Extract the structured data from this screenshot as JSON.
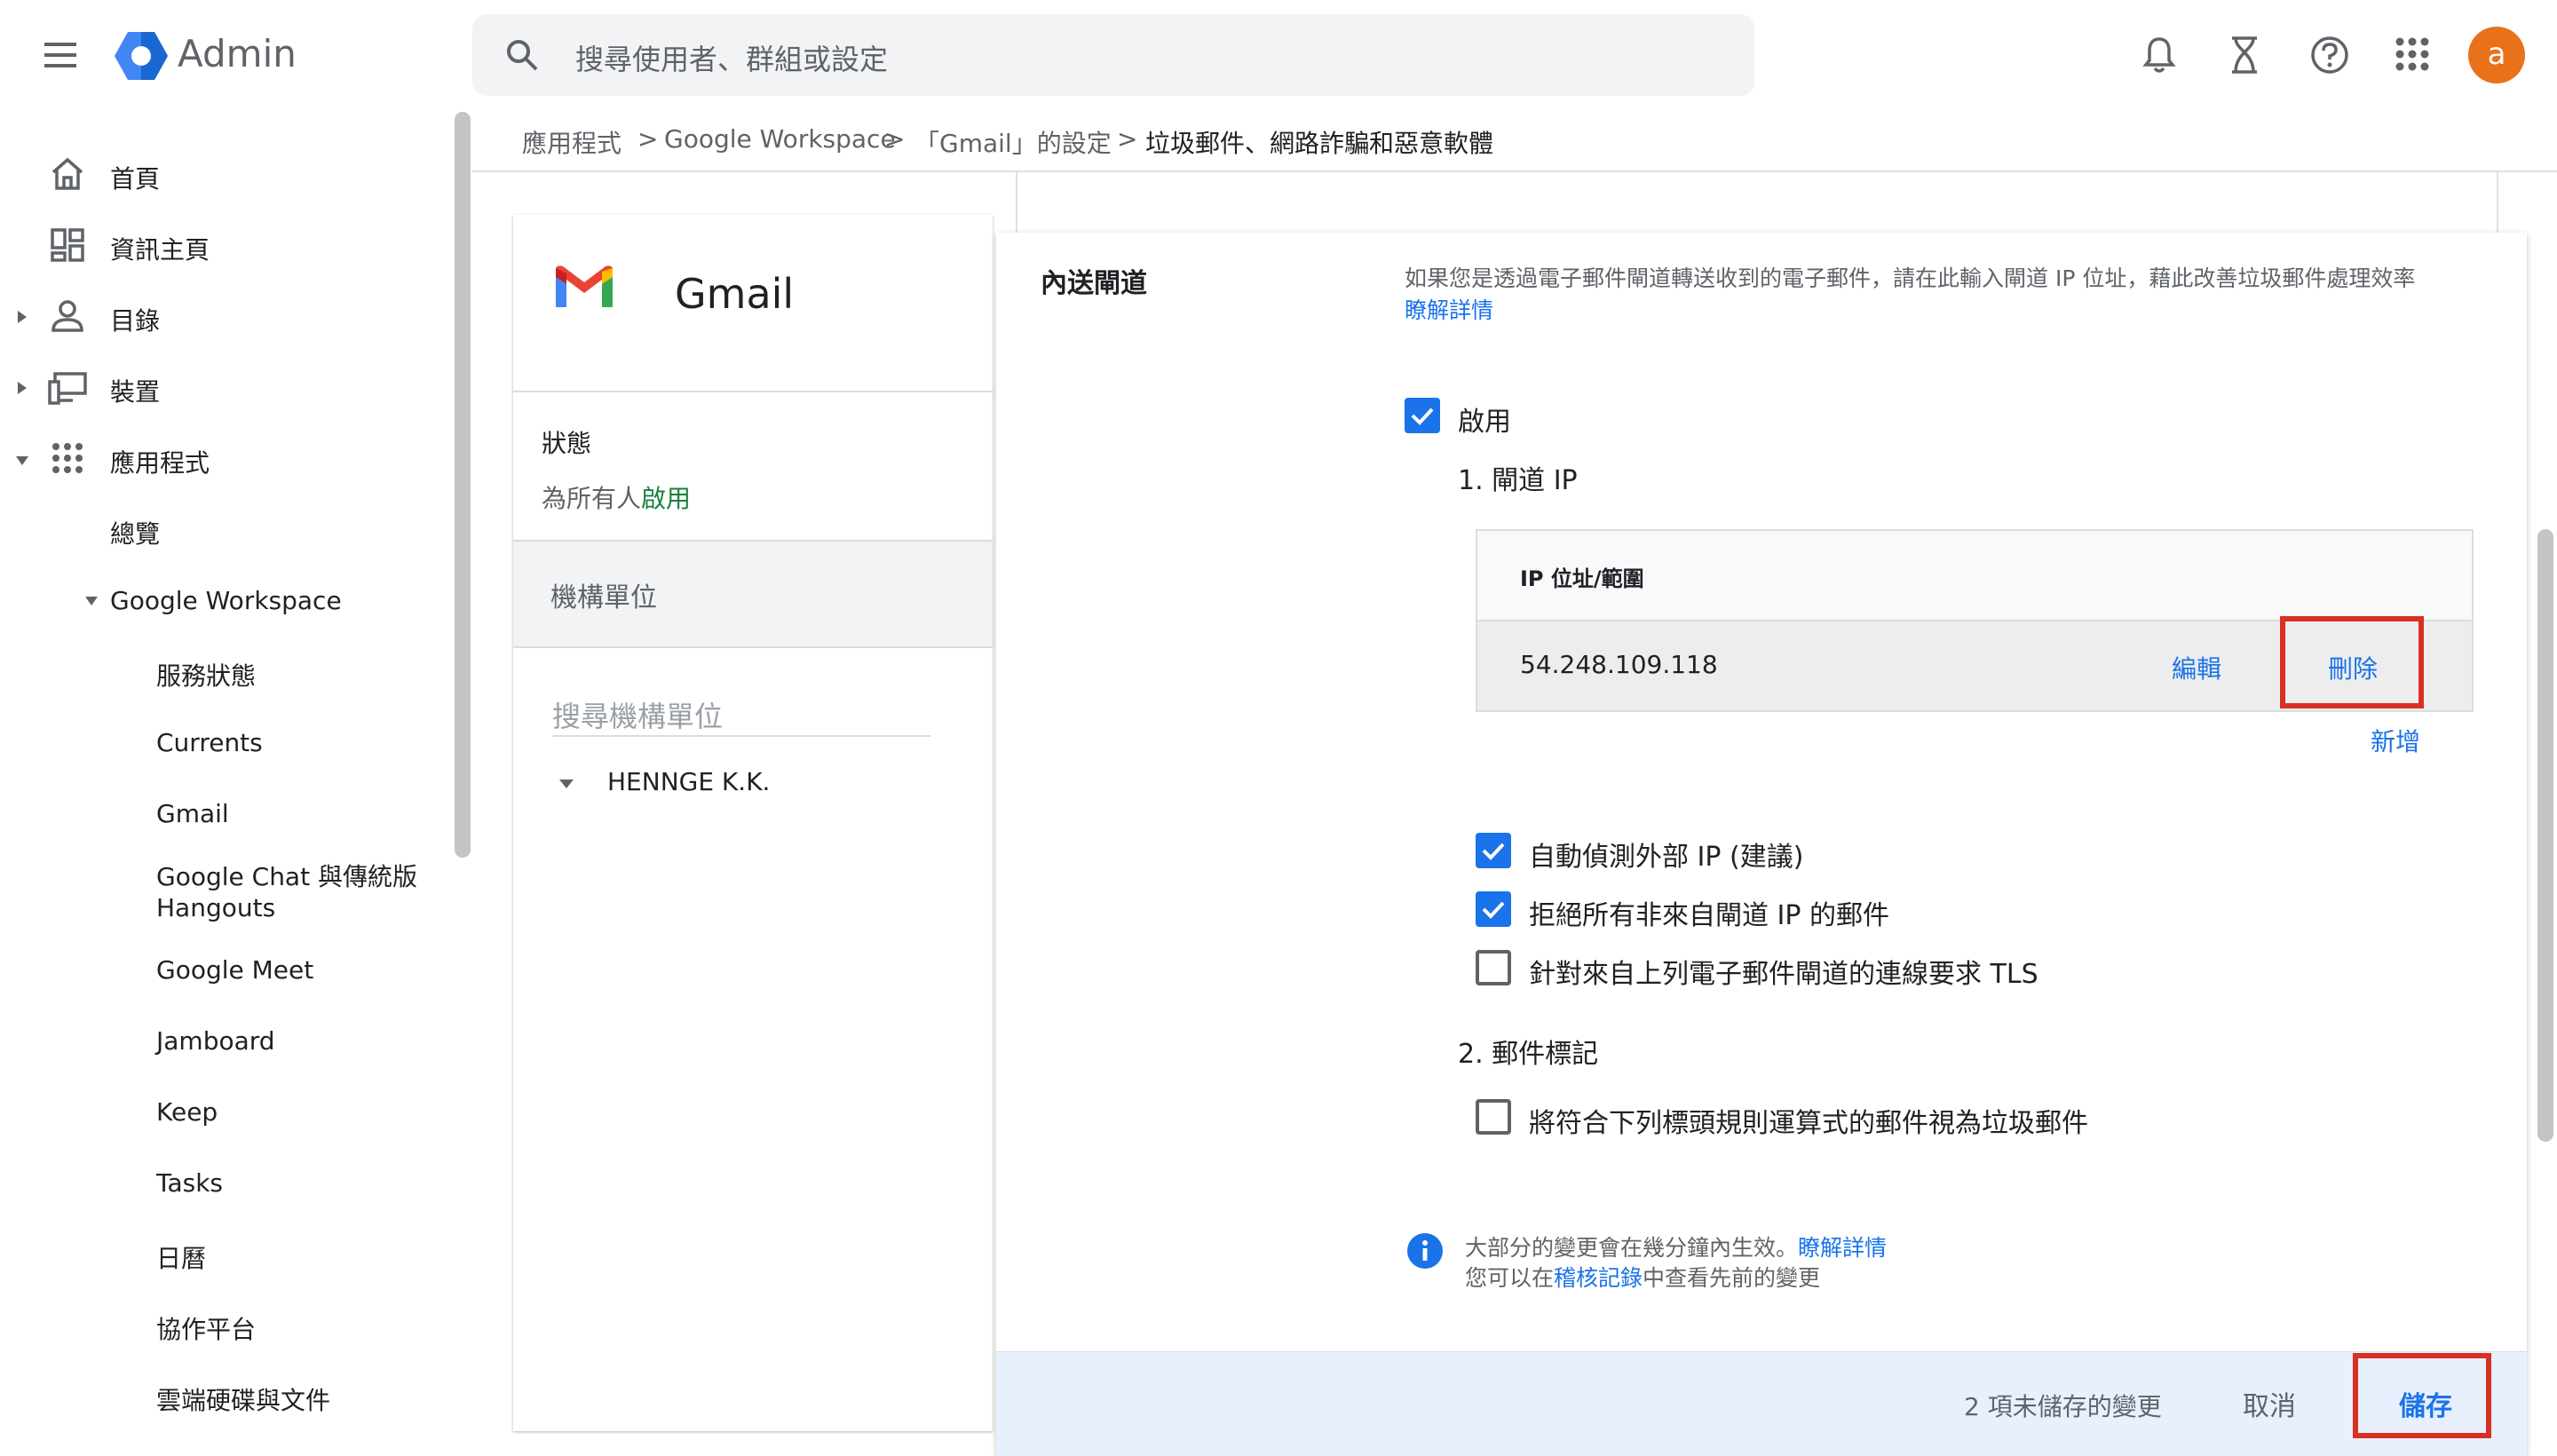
{
  "app": {
    "title": "Admin",
    "avatar_letter": "a"
  },
  "search": {
    "placeholder": "搜尋使用者、群組或設定"
  },
  "topbar_icons": [
    "menu-icon",
    "bell-icon",
    "hourglass-icon",
    "help-icon",
    "apps-grid-icon"
  ],
  "sidebar": {
    "items": [
      {
        "label": "首頁",
        "icon": "home-icon"
      },
      {
        "label": "資訊主頁",
        "icon": "dashboard-icon"
      },
      {
        "label": "目錄",
        "icon": "person-icon"
      },
      {
        "label": "裝置",
        "icon": "devices-icon"
      },
      {
        "label": "應用程式",
        "icon": "apps-icon"
      },
      {
        "label": "總覽"
      },
      {
        "label": "Google Workspace"
      },
      {
        "label": "服務狀態"
      },
      {
        "label": "Currents"
      },
      {
        "label": "Gmail"
      },
      {
        "label": "Google Chat 與傳統版"
      },
      {
        "label": "Hangouts"
      },
      {
        "label": "Google Meet"
      },
      {
        "label": "Jamboard"
      },
      {
        "label": "Keep"
      },
      {
        "label": "Tasks"
      },
      {
        "label": "日曆"
      },
      {
        "label": "協作平台"
      },
      {
        "label": "雲端硬碟與文件"
      }
    ]
  },
  "breadcrumb": {
    "items": [
      "應用程式",
      "Google Workspace",
      "「Gmail」的設定",
      "垃圾郵件、網路詐騙和惡意軟體"
    ],
    "separator": ">"
  },
  "left_card": {
    "app_name": "Gmail",
    "status_label": "狀態",
    "status_prefix": "為所有人",
    "status_value": "啟用",
    "org_unit_header": "機構單位",
    "org_search_placeholder": "搜尋機構單位",
    "org_root": "HENNGE K.K."
  },
  "panel": {
    "section_title": "內送閘道",
    "description": "如果您是透過電子郵件閘道轉送收到的電子郵件，請在此輸入閘道 IP 位址，藉此改善垃圾郵件處理效率",
    "learn_more": "瞭解詳情",
    "enable_label": "啟用",
    "gateway_ip_heading": "1. 閘道 IP",
    "table": {
      "header": "IP 位址/範圍",
      "rows": [
        {
          "ip": "54.248.109.118",
          "edit": "編輯",
          "delete": "刪除"
        }
      ],
      "add": "新增"
    },
    "options": [
      {
        "label": "自動偵測外部 IP (建議)",
        "checked": true
      },
      {
        "label": "拒絕所有非來自閘道 IP 的郵件",
        "checked": true
      },
      {
        "label": "針對來自上列電子郵件閘道的連線要求 TLS",
        "checked": false
      }
    ],
    "message_tagging_heading": "2. 郵件標記",
    "tagging_option": {
      "label": "將符合下列標頭規則運算式的郵件視為垃圾郵件",
      "checked": false
    },
    "info": {
      "line1_prefix": "大部分的變更會在幾分鐘內生效。",
      "line1_link": "瞭解詳情",
      "line2_prefix": "您可以在",
      "line2_link": "稽核記錄",
      "line2_suffix": "中查看先前的變更"
    }
  },
  "footer": {
    "unsaved": "2 項未儲存的變更",
    "cancel": "取消",
    "save": "儲存"
  },
  "colors": {
    "accent": "#1a73e8",
    "enabled_green": "#188038",
    "highlight_red": "#d93025",
    "avatar": "#e8711a"
  }
}
